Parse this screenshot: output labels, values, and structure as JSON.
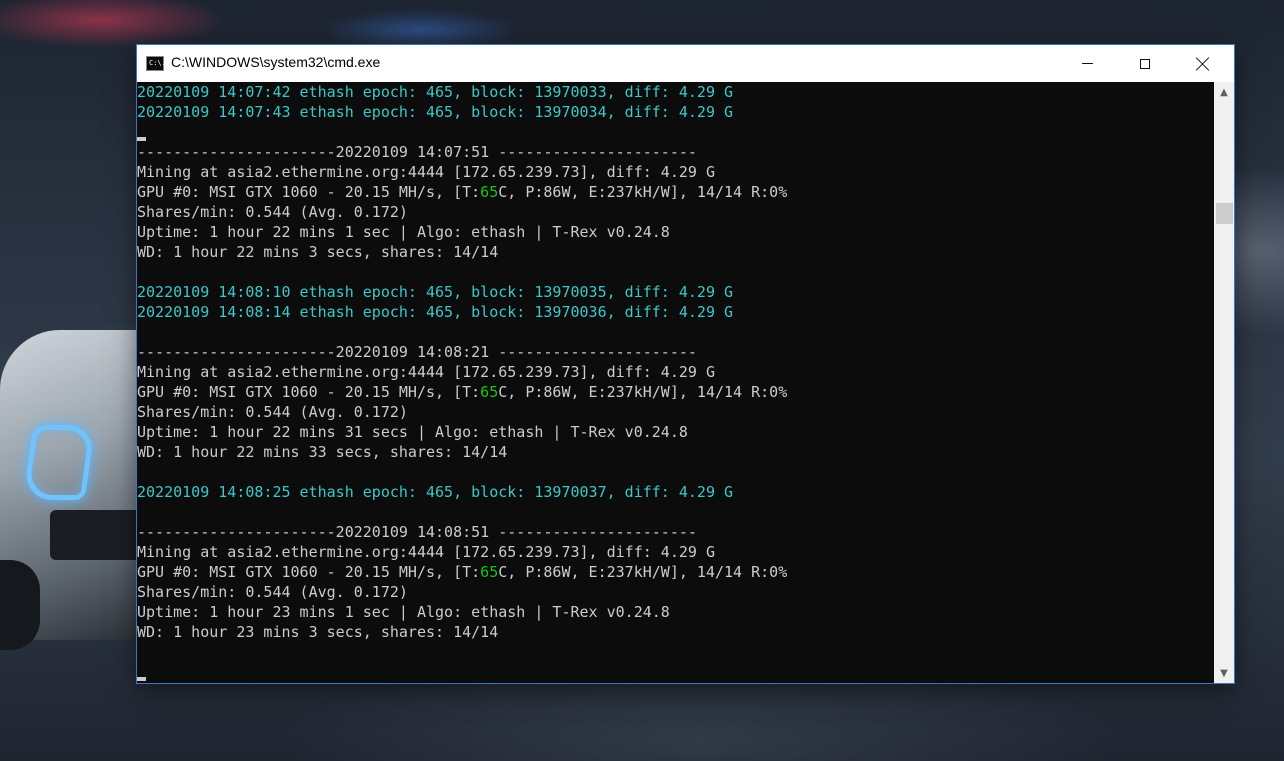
{
  "window": {
    "title": "C:\\WINDOWS\\system32\\cmd.exe",
    "icon": "cmd-icon",
    "icon_glyph": "C:\\."
  },
  "colors": {
    "console_bg": "#0c0c0c",
    "text": "#cccccc",
    "cyan": "#3cc8c8",
    "green": "#16c60c"
  },
  "console": {
    "blocks": {
      "job1": "20220109 14:07:42 ethash epoch: 465, block: 13970033, diff: 4.29 G",
      "job2": "20220109 14:07:43 ethash epoch: 465, block: 13970034, diff: 4.29 G",
      "r1": {
        "sep": "----------------------20220109 14:07:51 ----------------------",
        "mining": "Mining at asia2.ethermine.org:4444 [172.65.239.73], diff: 4.29 G",
        "gpu_pre": "GPU #0: MSI GTX 1060 - 20.15 MH/s, [T:",
        "gpu_temp": "65",
        "gpu_post": "C, P:86W, E:237kH/W], 14/14 R:0%",
        "shares": "Shares/min: 0.544 (Avg. 0.172)",
        "uptime": "Uptime: 1 hour 22 mins 1 sec | Algo: ethash | T-Rex v0.24.8",
        "wd": "WD: 1 hour 22 mins 3 secs, shares: 14/14"
      },
      "job3": "20220109 14:08:10 ethash epoch: 465, block: 13970035, diff: 4.29 G",
      "job4": "20220109 14:08:14 ethash epoch: 465, block: 13970036, diff: 4.29 G",
      "r2": {
        "sep": "----------------------20220109 14:08:21 ----------------------",
        "mining": "Mining at asia2.ethermine.org:4444 [172.65.239.73], diff: 4.29 G",
        "gpu_pre": "GPU #0: MSI GTX 1060 - 20.15 MH/s, [T:",
        "gpu_temp": "65",
        "gpu_post": "C, P:86W, E:237kH/W], 14/14 R:0%",
        "shares": "Shares/min: 0.544 (Avg. 0.172)",
        "uptime": "Uptime: 1 hour 22 mins 31 secs | Algo: ethash | T-Rex v0.24.8",
        "wd": "WD: 1 hour 22 mins 33 secs, shares: 14/14"
      },
      "job5": "20220109 14:08:25 ethash epoch: 465, block: 13970037, diff: 4.29 G",
      "r3": {
        "sep": "----------------------20220109 14:08:51 ----------------------",
        "mining": "Mining at asia2.ethermine.org:4444 [172.65.239.73], diff: 4.29 G",
        "gpu_pre": "GPU #0: MSI GTX 1060 - 20.15 MH/s, [T:",
        "gpu_temp": "65",
        "gpu_post": "C, P:86W, E:237kH/W], 14/14 R:0%",
        "shares": "Shares/min: 0.544 (Avg. 0.172)",
        "uptime": "Uptime: 1 hour 23 mins 1 sec | Algo: ethash | T-Rex v0.24.8",
        "wd": "WD: 1 hour 23 mins 3 secs, shares: 14/14"
      }
    }
  },
  "icons": {
    "minimize": "minimize-icon",
    "maximize": "maximize-icon",
    "close": "close-icon",
    "scroll_up": "▲",
    "scroll_down": "▼"
  }
}
